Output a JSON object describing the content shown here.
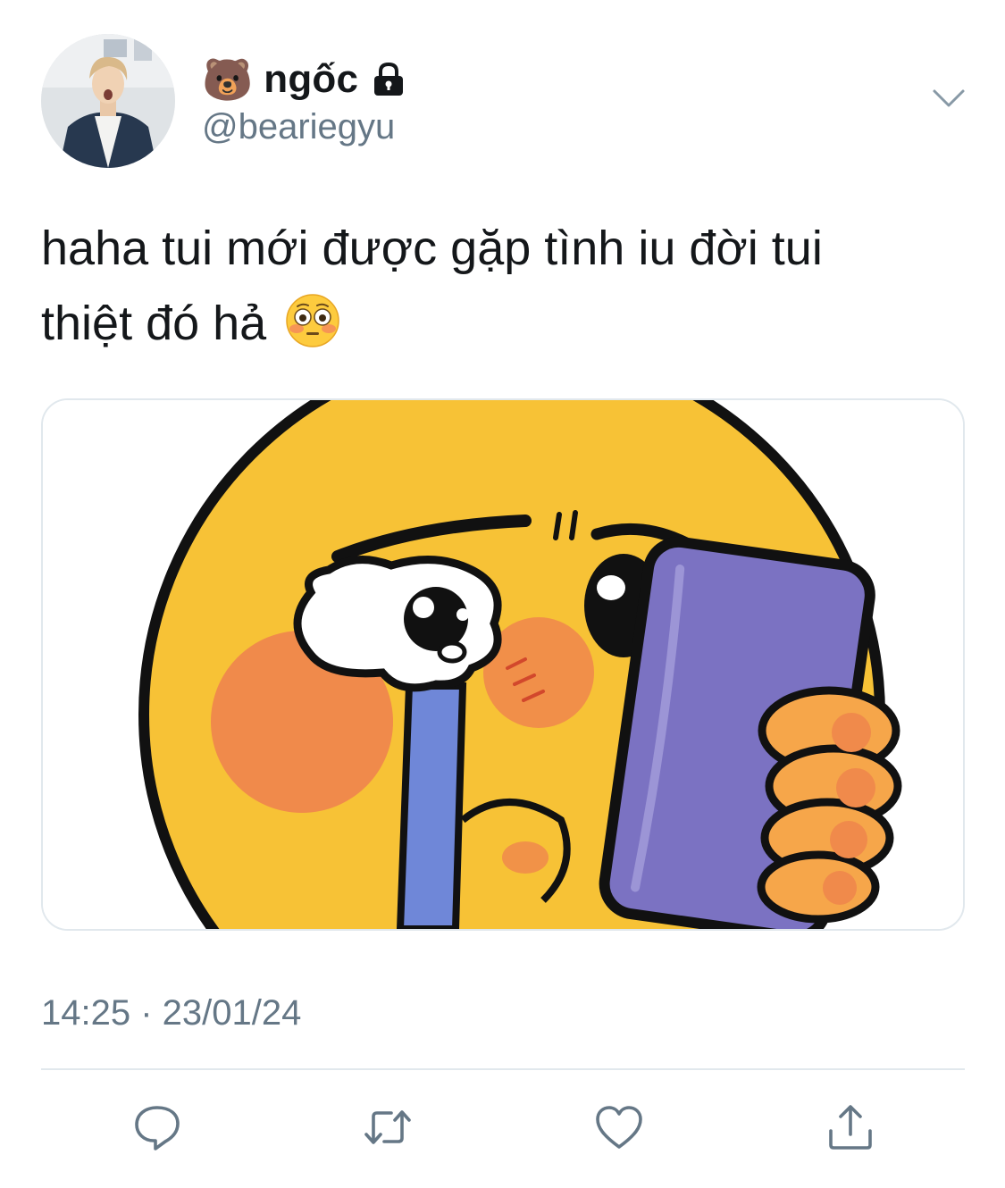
{
  "tweet": {
    "author": {
      "name_emoji": "🐻",
      "display_name": "ngốc",
      "handle": "@beariegyu",
      "locked": true
    },
    "text_lines": [
      "haha tui mới được gặp tình iu đời tui",
      "thiệt đó hả"
    ],
    "text_emoji": "flushed-face",
    "media": {
      "description_icon": "crying-emoji-holding-phone-sticker"
    },
    "timestamp": "14:25 · 23/01/24"
  },
  "actions": [
    {
      "name": "reply",
      "icon": "reply-icon"
    },
    {
      "name": "retweet",
      "icon": "retweet-icon"
    },
    {
      "name": "like",
      "icon": "heart-icon"
    },
    {
      "name": "share",
      "icon": "share-icon"
    }
  ],
  "colors": {
    "text_primary": "#14171a",
    "text_secondary": "#657786",
    "icon_gray": "#657786",
    "border": "#e1e8ed",
    "sticker_yellow": "#f7c236",
    "sticker_blush": "#f08a4b",
    "sticker_phone": "#7b72c2",
    "sticker_tear": "#6f87d8"
  }
}
